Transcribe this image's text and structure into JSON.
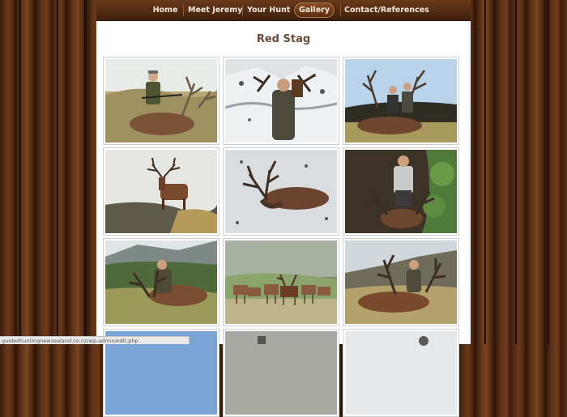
{
  "nav": {
    "items": [
      {
        "label": "Home",
        "active": false
      },
      {
        "label": "Meet Jeremy",
        "active": false
      },
      {
        "label": "Your Hunt",
        "active": false
      },
      {
        "label": "Gallery",
        "active": true
      },
      {
        "label": "Contact/References",
        "active": false
      }
    ]
  },
  "page": {
    "title": "Red Stag"
  },
  "gallery": {
    "photos": [
      {
        "subject": "hunter-with-stag"
      },
      {
        "subject": "hunter-carrying-antlers-snow"
      },
      {
        "subject": "two-hunters-with-stag"
      },
      {
        "subject": "stag-on-hilltop"
      },
      {
        "subject": "stag-in-snow"
      },
      {
        "subject": "hunter-with-stag-forest"
      },
      {
        "subject": "hunter-with-stag-hillside"
      },
      {
        "subject": "herd-of-deer"
      },
      {
        "subject": "hunter-with-stag-field"
      },
      {
        "subject": "partial-photo"
      },
      {
        "subject": "partial-photo"
      },
      {
        "subject": "partial-photo"
      }
    ]
  },
  "status": {
    "url": "guidedhuntingnewzealand.co.nz/wp-admin/edit.php"
  },
  "colors": {
    "nav_text": "#f3e8da",
    "title": "#6a4a3a",
    "wood": "#5a2f15"
  }
}
